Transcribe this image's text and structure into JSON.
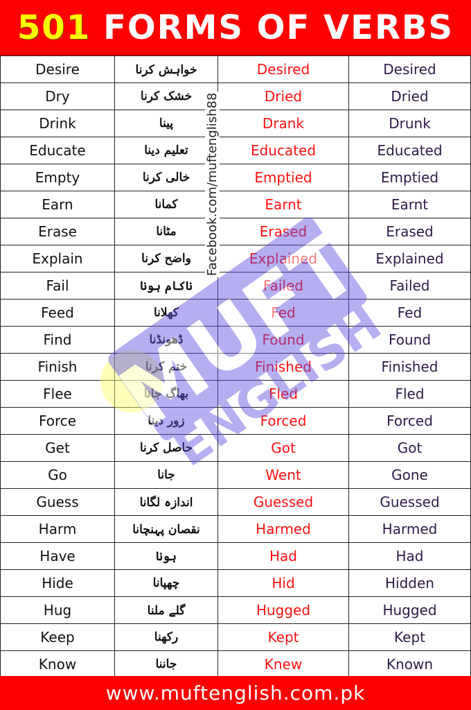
{
  "header": {
    "number": "501",
    "title": "FORMS OF VERBS"
  },
  "watermark": {
    "facebook": "Facebook.com/muftenglish88",
    "logo_text": "MUFT ENGLISH"
  },
  "rows": [
    [
      "Desire",
      "خواہش کرنا",
      "Desired",
      "Desired"
    ],
    [
      "Dry",
      "خشک کرنا",
      "Dried",
      "Dried"
    ],
    [
      "Drink",
      "پینا",
      "Drank",
      "Drunk"
    ],
    [
      "Educate",
      "تعلیم دینا",
      "Educated",
      "Educated"
    ],
    [
      "Empty",
      "خالی کرنا",
      "Emptied",
      "Emptied"
    ],
    [
      "Earn",
      "کمانا",
      "Earnt",
      "Earnt"
    ],
    [
      "Erase",
      "مٹانا",
      "Erased",
      "Erased"
    ],
    [
      "Explain",
      "واضح کرنا",
      "Explained",
      "Explained"
    ],
    [
      "Fail",
      "ناکام ہونا",
      "Failed",
      "Failed"
    ],
    [
      "Feed",
      "کھلانا",
      "Fed",
      "Fed"
    ],
    [
      "Find",
      "ڈھونڈنا",
      "Found",
      "Found"
    ],
    [
      "Finish",
      "ختم کرنا",
      "Finished",
      "Finished"
    ],
    [
      "Flee",
      "بھاگ جانا",
      "Fled",
      "Fled"
    ],
    [
      "Force",
      "زور دینا",
      "Forced",
      "Forced"
    ],
    [
      "Get",
      "حاصل کرنا",
      "Got",
      "Got"
    ],
    [
      "Go",
      "جانا",
      "Went",
      "Gone"
    ],
    [
      "Guess",
      "اندازہ لگانا",
      "Guessed",
      "Guessed"
    ],
    [
      "Harm",
      "نقصان پہنچانا",
      "Harmed",
      "Harmed"
    ],
    [
      "Have",
      "ہونا",
      "Had",
      "Had"
    ],
    [
      "Hide",
      "چھپانا",
      "Hid",
      "Hidden"
    ],
    [
      "Hug",
      "گلے ملنا",
      "Hugged",
      "Hugged"
    ],
    [
      "Keep",
      "رکھنا",
      "Kept",
      "Kept"
    ],
    [
      "Know",
      "جاننا",
      "Knew",
      "Known"
    ]
  ],
  "footer": {
    "url": "www.muftenglish.com.pk"
  },
  "colors": {
    "banner": "#ff0000",
    "number": "#ffff00",
    "past": "#ff1010",
    "participle": "#2e1a47",
    "watermark": "#5b4fe0"
  }
}
